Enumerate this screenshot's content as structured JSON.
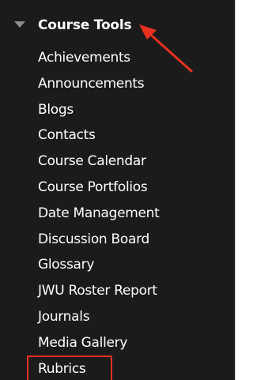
{
  "course_tools": {
    "header_label": "Course Tools",
    "items": [
      {
        "label": "Achievements"
      },
      {
        "label": "Announcements"
      },
      {
        "label": "Blogs"
      },
      {
        "label": "Contacts"
      },
      {
        "label": "Course Calendar"
      },
      {
        "label": "Course Portfolios"
      },
      {
        "label": "Date Management"
      },
      {
        "label": "Discussion Board"
      },
      {
        "label": "Glossary"
      },
      {
        "label": "JWU Roster Report"
      },
      {
        "label": "Journals"
      },
      {
        "label": "Media Gallery"
      },
      {
        "label": "Rubrics"
      }
    ]
  },
  "annotation": {
    "color": "#e8321f"
  }
}
